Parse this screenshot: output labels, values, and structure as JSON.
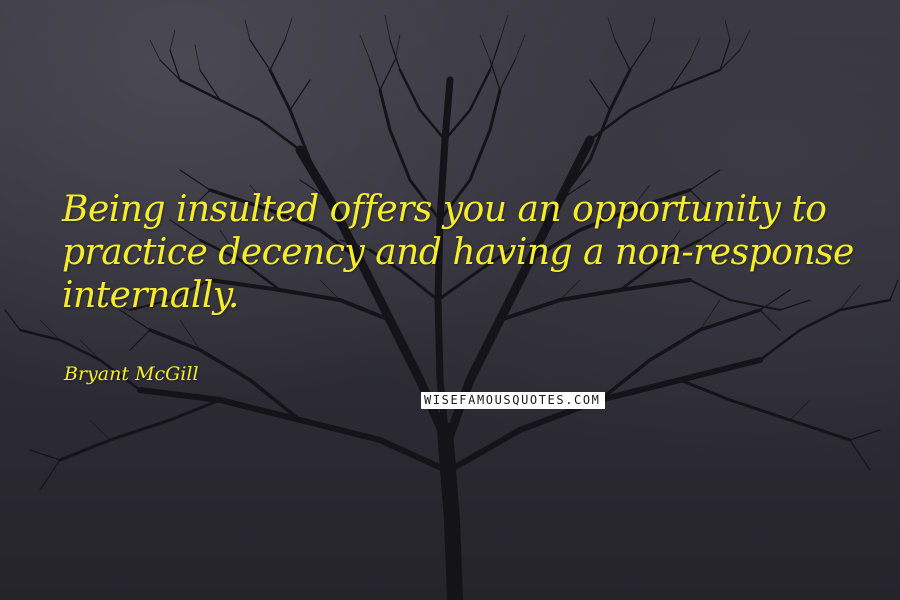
{
  "quote": {
    "line1": "Being insulted offers you an opportunity to",
    "line2": "practice decency and having a non-response",
    "line3": "internally."
  },
  "author": "Bryant McGill",
  "watermark": "WISEFAMOUSQUOTES.COM",
  "colors": {
    "text": "#f6ed2a",
    "sky": "#302f38",
    "tree": "#141318"
  }
}
